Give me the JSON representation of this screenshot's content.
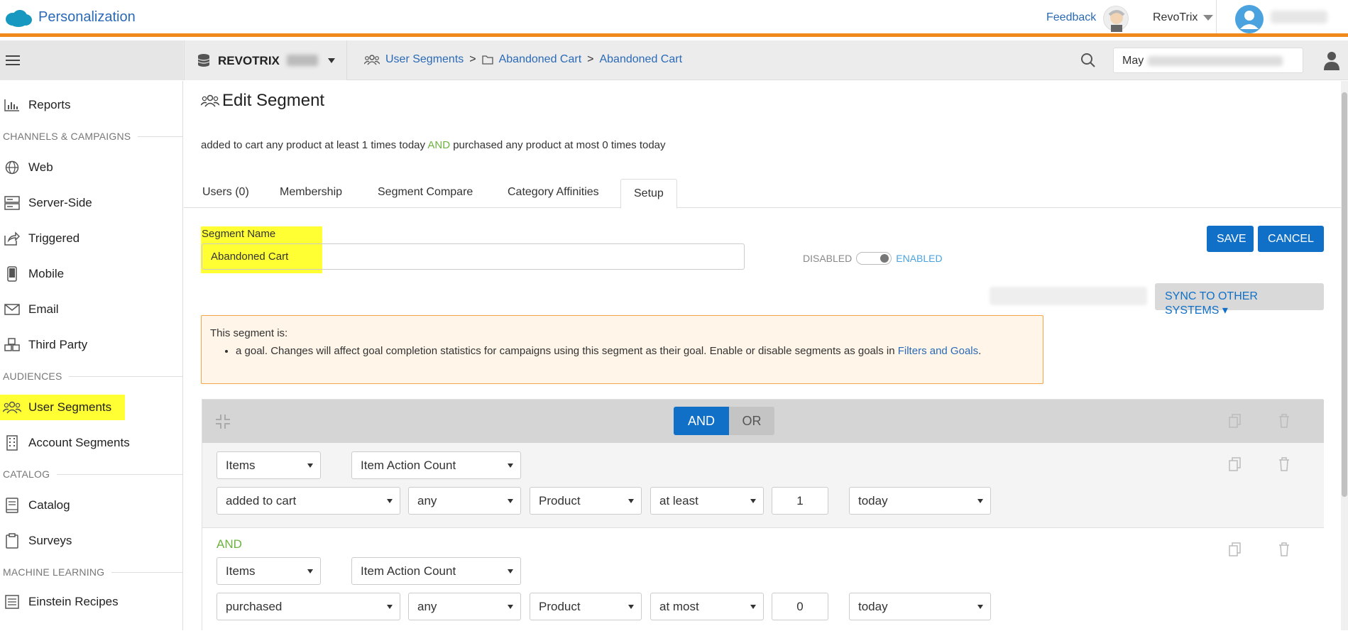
{
  "app": {
    "title": "Personalization",
    "feedback": "Feedback",
    "org": "RevoTrix"
  },
  "subbar": {
    "org_label": "REVOTRIX",
    "breadcrumbs": [
      "User Segments",
      "Abandoned Cart",
      "Abandoned Cart"
    ],
    "date_prefix": "May"
  },
  "sidebar": {
    "reports": "Reports",
    "sections": [
      "CHANNELS & CAMPAIGNS",
      "AUDIENCES",
      "CATALOG",
      "MACHINE LEARNING"
    ],
    "items": {
      "web": "Web",
      "server_side": "Server-Side",
      "triggered": "Triggered",
      "mobile": "Mobile",
      "email": "Email",
      "third_party": "Third Party",
      "user_segments": "User Segments",
      "account_segments": "Account Segments",
      "catalog": "Catalog",
      "surveys": "Surveys",
      "einstein_recipes": "Einstein Recipes"
    }
  },
  "page": {
    "title": "Edit Segment",
    "description_a": "added to cart any product at least 1 times today ",
    "description_and": "AND",
    "description_b": " purchased any product at most 0 times today",
    "tabs": [
      "Users (0)",
      "Membership",
      "Segment Compare",
      "Category Affinities",
      "Setup"
    ],
    "active_tab": "Setup"
  },
  "form": {
    "segment_name_label": "Segment Name",
    "segment_name_value": "Abandoned Cart",
    "toggle_disabled": "DISABLED",
    "toggle_enabled": "ENABLED",
    "save": "SAVE",
    "cancel": "CANCEL",
    "sync": "SYNC TO OTHER SYSTEMS ▾"
  },
  "notice": {
    "intro": "This segment is:",
    "bullet": "a goal. Changes will affect goal completion statistics for campaigns using this segment as their goal. Enable or disable segments as goals in ",
    "link": "Filters and Goals",
    "tail": "."
  },
  "rules": {
    "and": "AND",
    "or": "OR",
    "rule1": {
      "category": "Items",
      "type": "Item Action Count",
      "action": "added to cart",
      "scope": "any",
      "object": "Product",
      "operator": "at least",
      "count": "1",
      "period": "today"
    },
    "joiner": "AND",
    "rule2": {
      "category": "Items",
      "type": "Item Action Count",
      "action": "purchased",
      "scope": "any",
      "object": "Product",
      "operator": "at most",
      "count": "0",
      "period": "today"
    }
  },
  "colors": {
    "accent": "#1070c8",
    "orange": "#f08a1c",
    "highlight": "#ffff33",
    "green": "#6cb33f"
  }
}
